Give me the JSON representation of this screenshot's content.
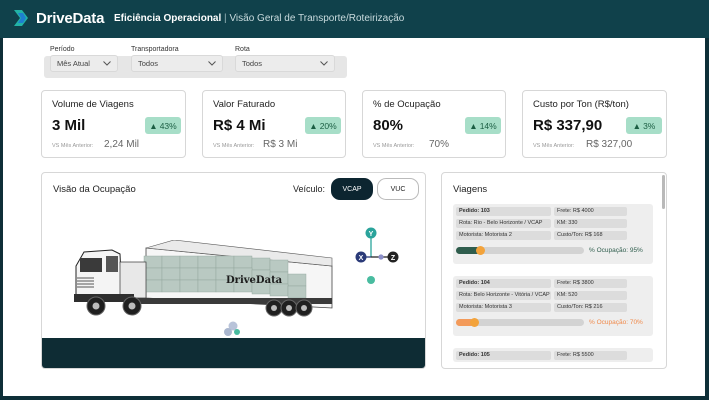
{
  "header": {
    "app_name": "DriveData",
    "title_bold": "Eficiência Operacional",
    "separator": "|",
    "subtitle": "Visão Geral de Transporte/Roteirização"
  },
  "filters": [
    {
      "label": "Período",
      "value": "Mês Atual"
    },
    {
      "label": "Transportadora",
      "value": "Todos"
    },
    {
      "label": "Rota",
      "value": "Todos"
    }
  ],
  "kpis": [
    {
      "title": "Volume de Viagens",
      "value": "3 Mil",
      "change": "43%",
      "prev_label": "VS Mês Anterior:",
      "prev_value": "2,24 Mil"
    },
    {
      "title": "Valor Faturado",
      "value": "R$ 4 Mi",
      "change": "20%",
      "prev_label": "VS Mês Anterior:",
      "prev_value": "R$ 3 Mi"
    },
    {
      "title": "% de Ocupação",
      "value": "80%",
      "change": "14%",
      "prev_label": "VS Mês Anterior:",
      "prev_value": "70%"
    },
    {
      "title": "Custo por Ton (R$/ton)",
      "value": "R$ 337,90",
      "change": "3%",
      "prev_label": "VS Mês Anterior:",
      "prev_value": "R$ 327,00"
    }
  ],
  "occupancy": {
    "title": "Visão da Ocupação",
    "vehicle_label": "Veículo:",
    "vehicles": [
      "VCAP",
      "VUC"
    ],
    "selected_vehicle": "VCAP",
    "truck_brand": "DriveData",
    "axes": [
      "Y",
      "X",
      "Z"
    ]
  },
  "trips": {
    "title": "Viagens",
    "items": [
      {
        "pedido": "Pedido: 103",
        "frete": "Frete: R$ 4000",
        "rota": "Rota: Rio - Belo Horizonte / VCAP",
        "km": "KM: 330",
        "motorista": "Motorista: Motorista 2",
        "custo": "Custo/Ton: R$ 168",
        "occupancy_text": "% Ocupação: 95%",
        "occupancy": 0.95,
        "color": "#2f5d4d",
        "knob": "#f3a33b"
      },
      {
        "pedido": "Pedido: 104",
        "frete": "Frete: R$ 3800",
        "rota": "Rota: Belo Horizonte - Vitória / VCAP",
        "km": "KM: 520",
        "motorista": "Motorista: Motorista 3",
        "custo": "Custo/Ton: R$ 216",
        "occupancy_text": "% Ocupação: 70%",
        "occupancy": 0.7,
        "color": "#f39a5a",
        "knob": "#f3a33b"
      },
      {
        "pedido": "Pedido: 105",
        "frete": "Frete: R$ 5500"
      }
    ]
  },
  "colors": {
    "accent": "#10414b",
    "badge": "#a7dec8",
    "dark": "#0e2c34"
  }
}
